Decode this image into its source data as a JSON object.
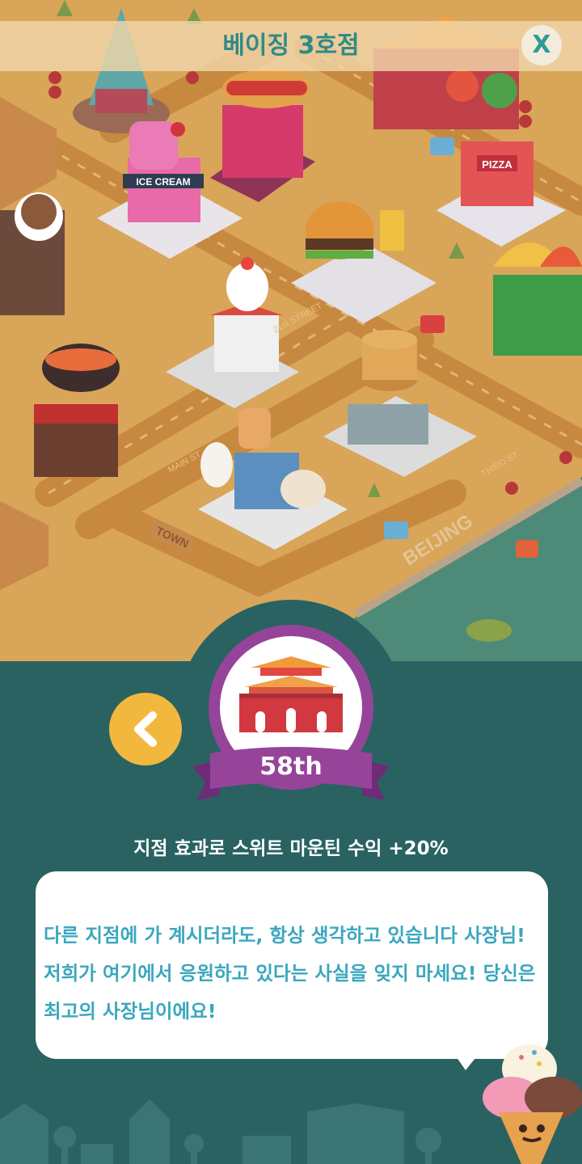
{
  "header": {
    "title": "베이징 3호점",
    "close_label": "X"
  },
  "map": {
    "shop_signs": [
      "ICE CREAM",
      "PIZZA"
    ],
    "street_signs": [
      "21st STREET",
      "MAIN ST",
      "THIRD ST"
    ],
    "town_sign": "TOWN",
    "city_sign": "BEIJING"
  },
  "branch": {
    "rank": "58th",
    "effect": "지점 효과로 스위트 마운틴 수익 +20%",
    "message": "다른 지점에 가 계시더라도, 항상 생각하고 있습니다 사장님! 저희가 여기에서 응원하고 있다는 사실을 잊지 마세요! 당신은 최고의 사장님이에요!"
  },
  "colors": {
    "ground": "#d9a559",
    "road": "#c98f45",
    "water": "#4e8a78",
    "panel": "#2a6262",
    "badge": "#96449a",
    "back_button": "#f2b83d",
    "title_text": "#2f8a87",
    "message_text": "#3aa7be"
  },
  "icons": [
    "close-icon",
    "back-chevron-icon",
    "forbidden-city-icon",
    "ice-cream-mascot-icon"
  ]
}
